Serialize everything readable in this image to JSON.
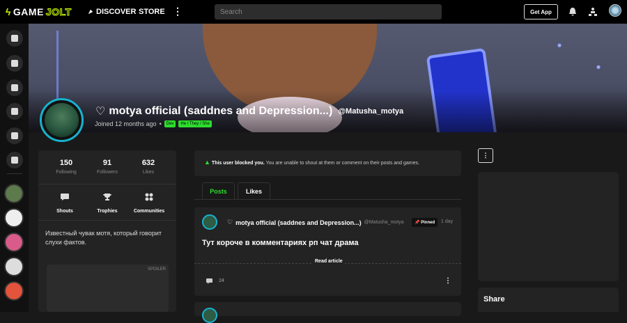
{
  "topbar": {
    "logo_game": "GAME",
    "logo_jolt": "JOLT",
    "discover": "DISCOVER",
    "store": "STORE",
    "more": "⋮",
    "search_placeholder": "Search",
    "get_app": "Get App"
  },
  "profile": {
    "name": "motya official (saddnes and Depression...)",
    "handle": "@Matusha_motya",
    "joined": "Joined 12 months ago",
    "tags": [
      "Dev",
      "He / They / She"
    ]
  },
  "stats": [
    {
      "n": "150",
      "label": "Following"
    },
    {
      "n": "91",
      "label": "Followers"
    },
    {
      "n": "632",
      "label": "Likes"
    }
  ],
  "actions": [
    {
      "icon": "shouts-icon",
      "label": "Shouts"
    },
    {
      "icon": "trophy-icon",
      "label": "Trophies"
    },
    {
      "icon": "communities-icon",
      "label": "Communities"
    }
  ],
  "bio": "Известный чувак мотя, который говорит слухи фактов.",
  "spoiler_label": "SPOILER",
  "blocked": {
    "bold": "This user blocked you.",
    "text": " You are unable to shout at them or comment on their posts and games."
  },
  "tabs": [
    "Posts",
    "Likes"
  ],
  "post": {
    "author": "motya official (saddnes and Depression...)",
    "handle": "@Matusha_motya",
    "pinned": "Pinned",
    "date": "1 day",
    "title": "Тут короче в комментариях рп чат драма",
    "read_article": "Read article",
    "comments": "24",
    "more": "⋮"
  },
  "right": {
    "more": "⋮",
    "share": "Share"
  },
  "colors": {
    "accent": "#2ddd2d",
    "avatar_ring": "#17b3cf",
    "logo": "#ccff00"
  }
}
